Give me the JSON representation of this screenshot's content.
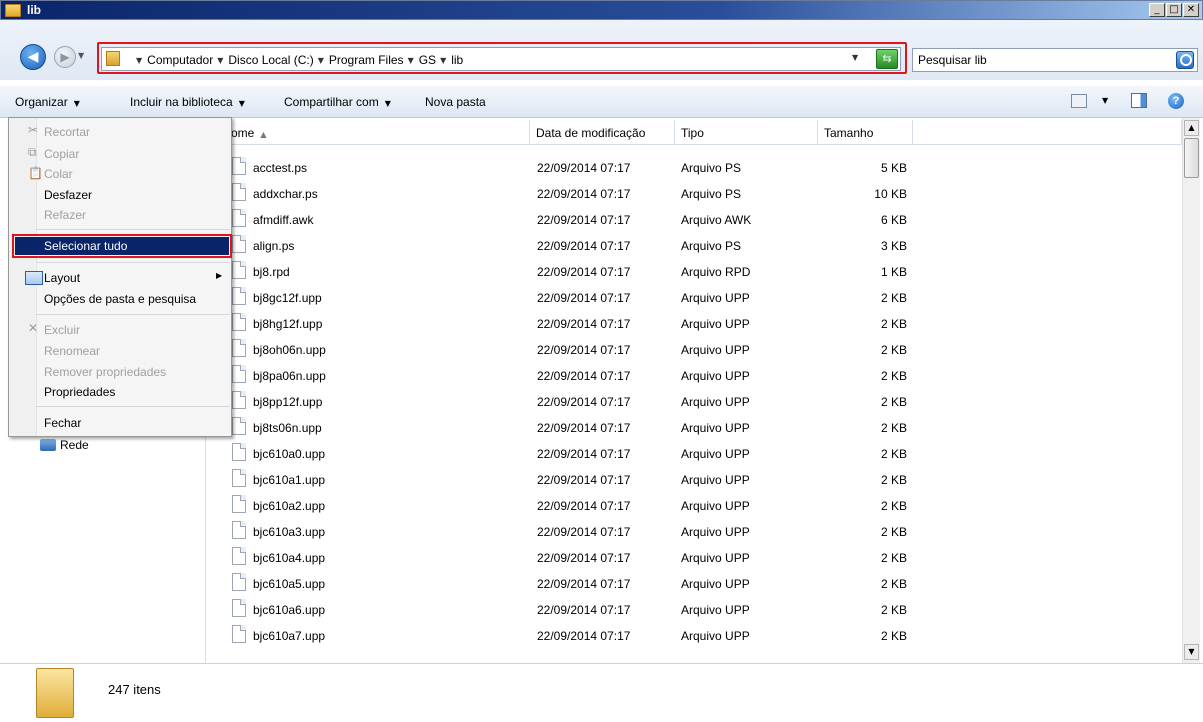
{
  "window": {
    "title": "lib"
  },
  "address": {
    "crumbs": [
      "Computador",
      "Disco Local (C:)",
      "Program Files",
      "GS",
      "lib"
    ],
    "search_placeholder": "Pesquisar lib"
  },
  "toolbar": {
    "organize": "Organizar",
    "include": "Incluir na biblioteca",
    "share": "Compartilhar com",
    "new_folder": "Nova pasta"
  },
  "menu": {
    "cut": "Recortar",
    "copy": "Copiar",
    "paste": "Colar",
    "undo": "Desfazer",
    "redo": "Refazer",
    "select_all": "Selecionar tudo",
    "layout": "Layout",
    "folder_options": "Opções de pasta e pesquisa",
    "delete": "Excluir",
    "rename": "Renomear",
    "remove_props": "Remover propriedades",
    "properties": "Propriedades",
    "close": "Fechar"
  },
  "nav": {
    "network": "Rede"
  },
  "columns": {
    "name": "ome",
    "date": "Data de modificação",
    "type": "Tipo",
    "size": "Tamanho"
  },
  "files": [
    {
      "name": "acctest.ps",
      "date": "22/09/2014 07:17",
      "type": "Arquivo PS",
      "size": "5 KB"
    },
    {
      "name": "addxchar.ps",
      "date": "22/09/2014 07:17",
      "type": "Arquivo PS",
      "size": "10 KB"
    },
    {
      "name": "afmdiff.awk",
      "date": "22/09/2014 07:17",
      "type": "Arquivo AWK",
      "size": "6 KB"
    },
    {
      "name": "align.ps",
      "date": "22/09/2014 07:17",
      "type": "Arquivo PS",
      "size": "3 KB"
    },
    {
      "name": "bj8.rpd",
      "date": "22/09/2014 07:17",
      "type": "Arquivo RPD",
      "size": "1 KB"
    },
    {
      "name": "bj8gc12f.upp",
      "date": "22/09/2014 07:17",
      "type": "Arquivo UPP",
      "size": "2 KB"
    },
    {
      "name": "bj8hg12f.upp",
      "date": "22/09/2014 07:17",
      "type": "Arquivo UPP",
      "size": "2 KB"
    },
    {
      "name": "bj8oh06n.upp",
      "date": "22/09/2014 07:17",
      "type": "Arquivo UPP",
      "size": "2 KB"
    },
    {
      "name": "bj8pa06n.upp",
      "date": "22/09/2014 07:17",
      "type": "Arquivo UPP",
      "size": "2 KB"
    },
    {
      "name": "bj8pp12f.upp",
      "date": "22/09/2014 07:17",
      "type": "Arquivo UPP",
      "size": "2 KB"
    },
    {
      "name": "bj8ts06n.upp",
      "date": "22/09/2014 07:17",
      "type": "Arquivo UPP",
      "size": "2 KB"
    },
    {
      "name": "bjc610a0.upp",
      "date": "22/09/2014 07:17",
      "type": "Arquivo UPP",
      "size": "2 KB"
    },
    {
      "name": "bjc610a1.upp",
      "date": "22/09/2014 07:17",
      "type": "Arquivo UPP",
      "size": "2 KB"
    },
    {
      "name": "bjc610a2.upp",
      "date": "22/09/2014 07:17",
      "type": "Arquivo UPP",
      "size": "2 KB"
    },
    {
      "name": "bjc610a3.upp",
      "date": "22/09/2014 07:17",
      "type": "Arquivo UPP",
      "size": "2 KB"
    },
    {
      "name": "bjc610a4.upp",
      "date": "22/09/2014 07:17",
      "type": "Arquivo UPP",
      "size": "2 KB"
    },
    {
      "name": "bjc610a5.upp",
      "date": "22/09/2014 07:17",
      "type": "Arquivo UPP",
      "size": "2 KB"
    },
    {
      "name": "bjc610a6.upp",
      "date": "22/09/2014 07:17",
      "type": "Arquivo UPP",
      "size": "2 KB"
    },
    {
      "name": "bjc610a7.upp",
      "date": "22/09/2014 07:17",
      "type": "Arquivo UPP",
      "size": "2 KB"
    }
  ],
  "status": {
    "count": "247 itens"
  },
  "colors": {
    "highlight": "#e0141d",
    "selection": "#0a246a"
  }
}
